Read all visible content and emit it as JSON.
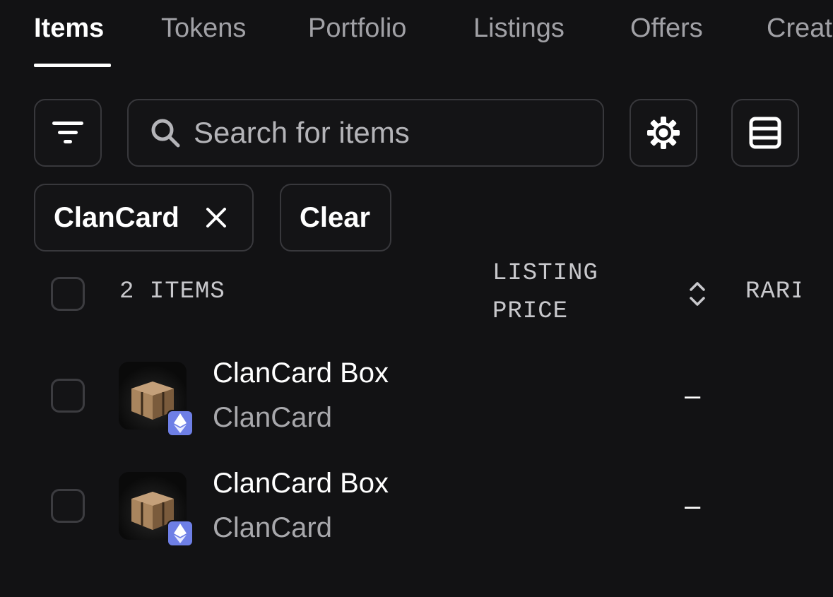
{
  "tabs": [
    {
      "label": "Items",
      "active": true
    },
    {
      "label": "Tokens",
      "active": false
    },
    {
      "label": "Portfolio",
      "active": false
    },
    {
      "label": "Listings",
      "active": false
    },
    {
      "label": "Offers",
      "active": false
    },
    {
      "label": "Created",
      "active": false
    }
  ],
  "toolbar": {
    "filter_icon": "filter-lines-icon",
    "search_icon": "magnifier-icon",
    "search_placeholder": "Search for items",
    "settings_icon": "gear-icon",
    "view_icon": "list-view-icon"
  },
  "chips": {
    "active_filter": "ClanCard",
    "remove_icon": "close-icon",
    "clear_label": "Clear"
  },
  "table": {
    "count_label": "2 ITEMS",
    "col_listing_price": "LISTING PRICE",
    "sort_icon": "sort-up-down-icon",
    "col_rarity": "RARITY",
    "rows": [
      {
        "name": "ClanCard Box",
        "collection": "ClanCard",
        "price": "–",
        "chain_icon": "ethereum-icon"
      },
      {
        "name": "ClanCard Box",
        "collection": "ClanCard",
        "price": "–",
        "chain_icon": "ethereum-icon"
      }
    ]
  },
  "colors": {
    "background": "#121214",
    "border": "#38383c",
    "eth_badge": "#6e7fe6"
  }
}
